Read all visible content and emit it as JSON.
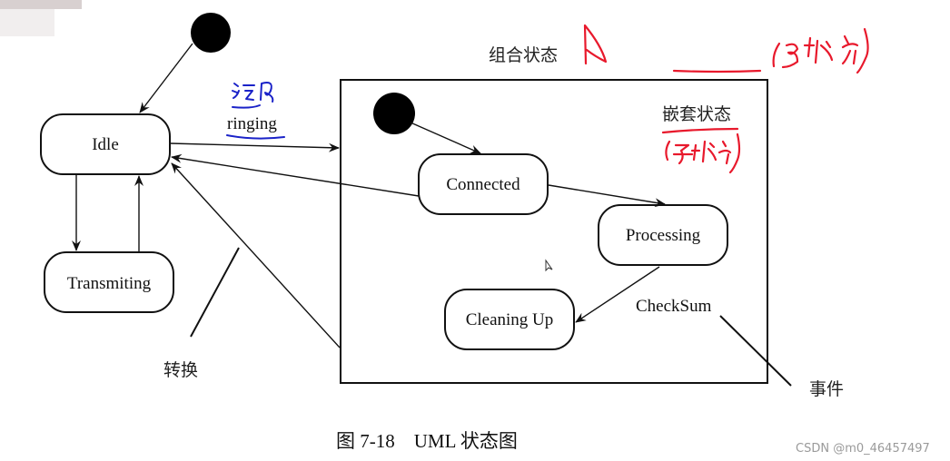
{
  "diagram": {
    "type": "UML state diagram",
    "caption": "图 7-18　UML 状态图",
    "states": {
      "idle": "Idle",
      "transmiting": "Transmiting",
      "connected": "Connected",
      "processing": "Processing",
      "cleaning_up": "Cleaning Up"
    },
    "composite_state_label": "组合状态",
    "nested_state_label": "嵌套状态",
    "transition_event": "ringing",
    "event_label": "CheckSum",
    "callouts": {
      "transition": "转换",
      "event": "事件"
    },
    "annotations": {
      "handwritten_red_1": "A",
      "handwritten_red_2": "(超状态)",
      "handwritten_red_3": "(子状态)",
      "handwritten_blue": "迁移"
    }
  },
  "watermark": "CSDN @m0_46457497",
  "colors": {
    "line": "#111111",
    "annotation_red": "#e8192c",
    "annotation_blue": "#1a22c8"
  }
}
